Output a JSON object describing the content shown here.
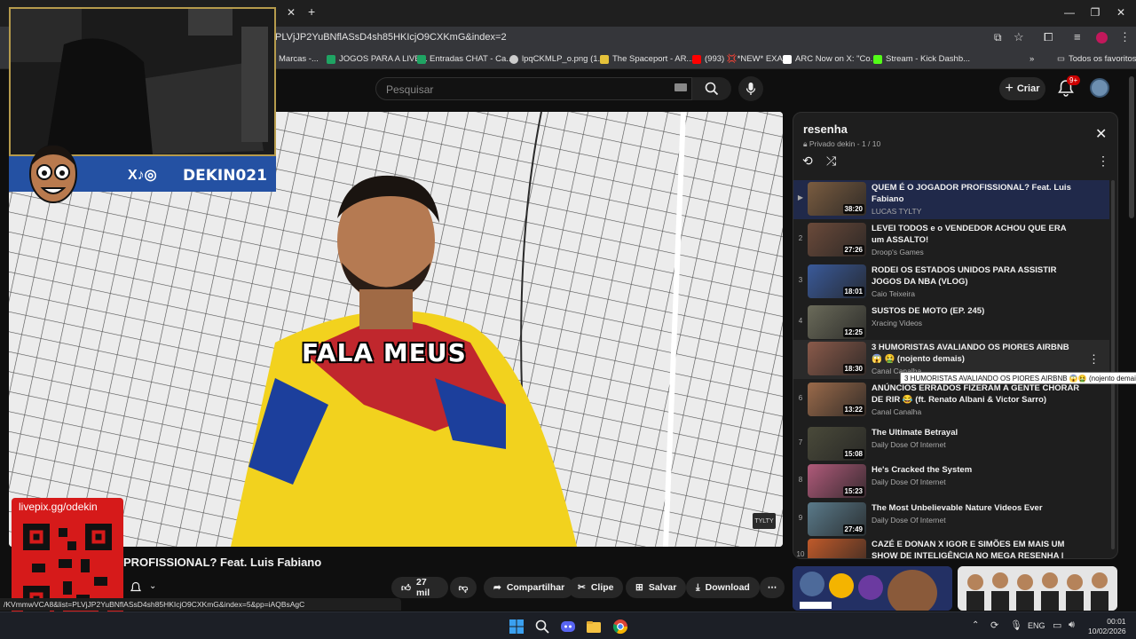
{
  "browser": {
    "url": "PLVjJP2YuBNflASsD4sh85HKIcjO9CXKmG&index=2",
    "bookmarks": [
      {
        "label": "Marcas -...",
        "color": "#888888"
      },
      {
        "label": "JOGOS PARA A LIVE...",
        "color": "#1fa463"
      },
      {
        "label": "Entradas CHAT - Ca...",
        "color": "#1fa463"
      },
      {
        "label": "lpqCKMLP_o.png (1...",
        "color": "#cccccc"
      },
      {
        "label": "The Spaceport - AR...",
        "color": "#e5c23a"
      },
      {
        "label": "(993) 💢*NEW* EXA...",
        "color": "#ff0000"
      },
      {
        "label": "ARC Now on X: \"Co...",
        "color": "#ffffff"
      },
      {
        "label": "Stream - Kick Dashb...",
        "color": "#53fc18"
      }
    ],
    "all_bookmarks": "Todos os favoritos"
  },
  "yt": {
    "search_placeholder": "Pesquisar",
    "create_label": "Criar",
    "notif_count": "9+"
  },
  "player": {
    "caption": "FALA MEUS",
    "watermark": "TYLTY"
  },
  "overlay": {
    "social_handle": "DEKIN021",
    "social_icons": "X♪◎",
    "qr_url": "livepix.gg/odekin"
  },
  "video": {
    "title": "PROFISSIONAL? Feat. Luis Fabiano",
    "likes": "27 mil",
    "share": "Compartilhar",
    "clip": "Clipe",
    "save": "Salvar",
    "download": "Download"
  },
  "status_url": "/KVmmwVCA8&list=PLVjJP2YuBNflASsD4sh85HKIcjO9CXKmG&index=5&pp=iAQBsAgC",
  "playlist": {
    "title": "resenha",
    "subtitle": "Privado dekin - 1 / 10",
    "items": [
      {
        "idx": "▶",
        "title": "QUEM É O JOGADOR PROFISSIONAL? Feat. Luis Fabiano",
        "channel": "LUCAS TYLTY",
        "duration": "38:20",
        "thumb": "#7a5c40"
      },
      {
        "idx": "2",
        "title": "LEVEI TODOS e o VENDEDOR ACHOU QUE ERA um ASSALTO!",
        "channel": "Droop's Games",
        "duration": "27:26",
        "thumb": "#6b4a3a"
      },
      {
        "idx": "3",
        "title": "RODEI OS ESTADOS UNIDOS PARA ASSISTIR JOGOS DA NBA (VLOG)",
        "channel": "Caio Teixeira",
        "duration": "18:01",
        "thumb": "#3a5a9a"
      },
      {
        "idx": "4",
        "title": "SUSTOS DE MOTO (EP. 245)",
        "channel": "Xracing Videos",
        "duration": "12:25",
        "thumb": "#6b6b5a"
      },
      {
        "idx": "",
        "title": "3 HUMORISTAS AVALIANDO OS PIORES AIRBNB 😱 🤮 (nojento demais)",
        "channel": "Canal Canalha",
        "duration": "18:30",
        "thumb": "#8a5a4a"
      },
      {
        "idx": "6",
        "title": "ANÚNCIOS ERRADOS FIZERAM A GENTE CHORAR DE RIR 😂 (ft. Renato Albani & Victor Sarro)",
        "channel": "Canal Canalha",
        "duration": "13:22",
        "thumb": "#9a6a4a"
      },
      {
        "idx": "7",
        "title": "The Ultimate Betrayal",
        "channel": "Daily Dose Of Internet",
        "duration": "15:08",
        "thumb": "#4a4a3a"
      },
      {
        "idx": "8",
        "title": "He's Cracked the System",
        "channel": "Daily Dose Of Internet",
        "duration": "15:23",
        "thumb": "#b05a7a"
      },
      {
        "idx": "9",
        "title": "The Most Unbelievable Nature Videos Ever",
        "channel": "Daily Dose Of Internet",
        "duration": "27:49",
        "thumb": "#5a7a8a"
      },
      {
        "idx": "10",
        "title": "CAZÉ E DONAN X IGOR E SIMÕES EM MAIS UM SHOW DE INTELIGÊNCIA NO MEGA RESENHA | RODA DE...",
        "channel": "",
        "duration": "",
        "thumb": "#c05a2a"
      }
    ]
  },
  "tooltip": "3 HUMORISTAS AVALIANDO OS PIORES AIRBNB 😱🤮 (nojento demais)",
  "taskbar": {
    "lang": "ENG",
    "time": "00:01",
    "date": "10/02/2026"
  }
}
